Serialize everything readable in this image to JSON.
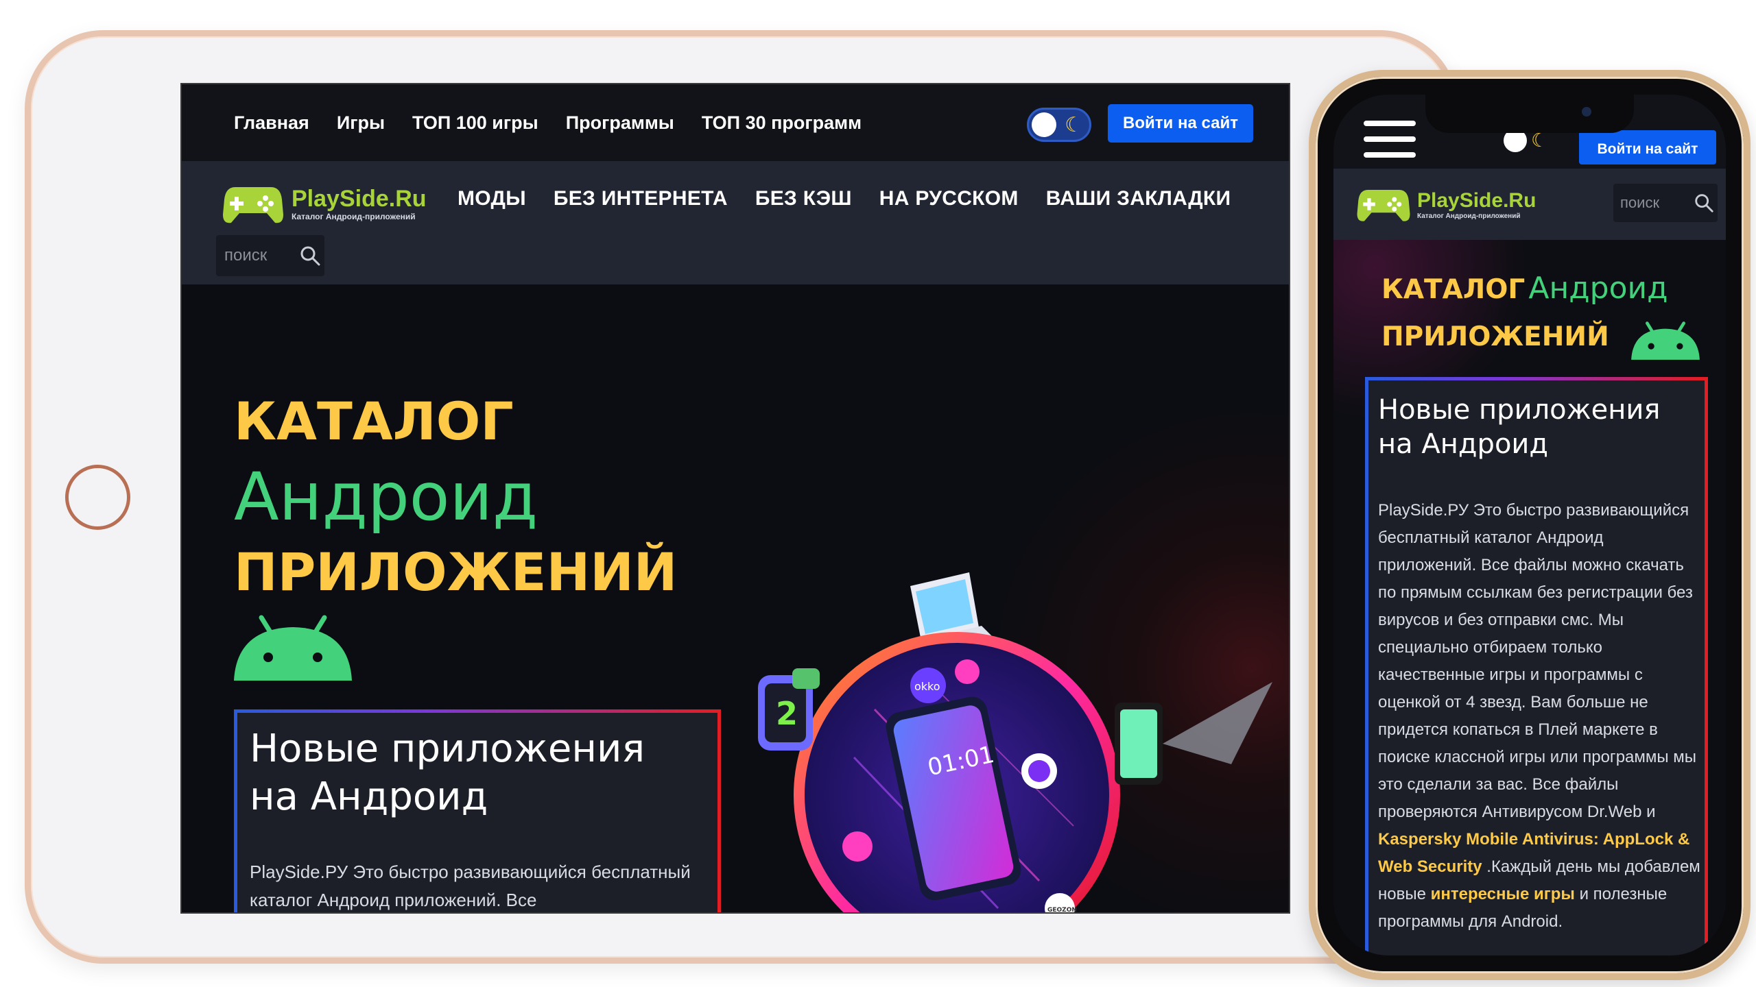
{
  "site": {
    "logo_title": "PlaySide.Ru",
    "logo_subtitle": "Каталог Андроид-приложений",
    "login_label": "Войти на сайт",
    "search_placeholder": "поиск"
  },
  "top_nav": [
    "Главная",
    "Игры",
    "ТОП 100 игры",
    "Программы",
    "ТОП 30 программ"
  ],
  "category_nav": [
    "МОДЫ",
    "БЕЗ ИНТЕРНЕТА",
    "БЕЗ КЭШ",
    "НА РУССКОМ",
    "ВАШИ ЗАКЛАДКИ"
  ],
  "hero": {
    "title_line1": "КАТАЛОГ",
    "title_line2": "Андроид",
    "title_line3": "ПРИЛОЖЕНИЙ"
  },
  "new_apps": {
    "heading_line1": "Новые приложения",
    "heading_line2": "на Андроид",
    "tablet_text": "PlaySide.РУ Это быстро развивающийся бесплатный каталог Андроид приложений. Все",
    "phone_text_intro": "PlaySide.РУ Это быстро развивающийся бесплатный каталог Андроид приложений. Все файлы можно скачать по прямым ссылкам без регистрации без вирусов и без отправки смс. Мы специально отбираем только качественные игры и программы с оценкой от 4 звезд. Вам больше не придется копаться в Плей маркете в поиске классной игры или программы мы это сделали за вас. Все файлы проверяются Антивирусом Dr.Web и",
    "phone_text_highlight1": "Kaspersky Mobile Antivirus: AppLock & Web Security",
    "phone_text_mid": ".Каждый день мы добавлем новые",
    "phone_text_highlight2": "интересные игры",
    "phone_text_end": "и полезные программы для Android."
  },
  "hero_art_labels": {
    "watch_digit": "2",
    "phone_time": "01:01",
    "badge_okko": "okko",
    "badge_geozon": "GEOZON"
  },
  "colors": {
    "accent_blue": "#0c5ef0",
    "title_yellow": "#fdc946",
    "title_green": "#43d27b",
    "logo_green": "#a8d43a",
    "header_bg": "#222632",
    "topbar_bg": "#111319"
  }
}
